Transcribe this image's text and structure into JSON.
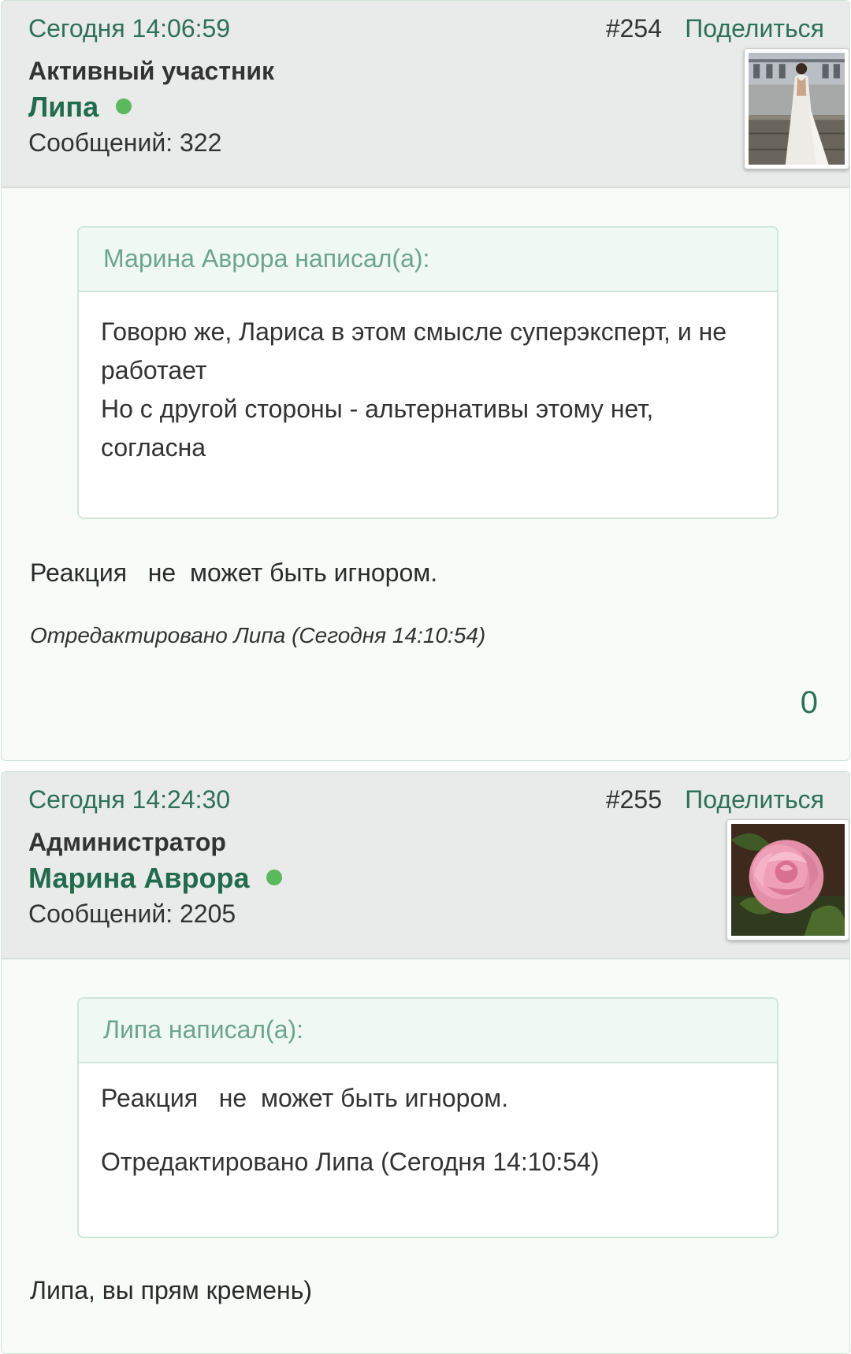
{
  "posts": [
    {
      "date": "Сегодня 14:06:59",
      "number": "#254",
      "share_label": "Поделиться",
      "user_title": "Активный участник",
      "user_name": "Липа",
      "user_posts": "Сообщений: 322",
      "quote": {
        "author": "Марина Аврора написал(а):",
        "lines": [
          "Говорю же, Лариса в этом смысле суперэксперт, и не работает",
          "Но с другой стороны - альтернативы этому нет, согласна"
        ]
      },
      "text": "Реакция   не  может быть игнором.",
      "edited": "Отредактировано Липа (Сегодня 14:10:54)",
      "reactions": "0"
    },
    {
      "date": "Сегодня 14:24:30",
      "number": "#255",
      "share_label": "Поделиться",
      "user_title": "Администратор",
      "user_name": "Марина Аврора",
      "user_posts": "Сообщений: 2205",
      "quote": {
        "author": "Липа написал(а):",
        "lines": [
          "Реакция   не  может быть игнором.",
          "Отредактировано Липа (Сегодня 14:10:54)"
        ]
      },
      "text": "Липа, вы прям кремень)"
    }
  ],
  "colors": {
    "accent_green": "#2e7058",
    "username_green": "#236b4d",
    "online_dot": "#5cb85c",
    "header_bg": "#e8ebe9",
    "post_bg": "#f7fcf9",
    "quote_header_bg": "#eff8f2"
  },
  "icons": [
    "online-status-icon",
    "user-avatar-photo",
    "user-avatar-rose"
  ]
}
